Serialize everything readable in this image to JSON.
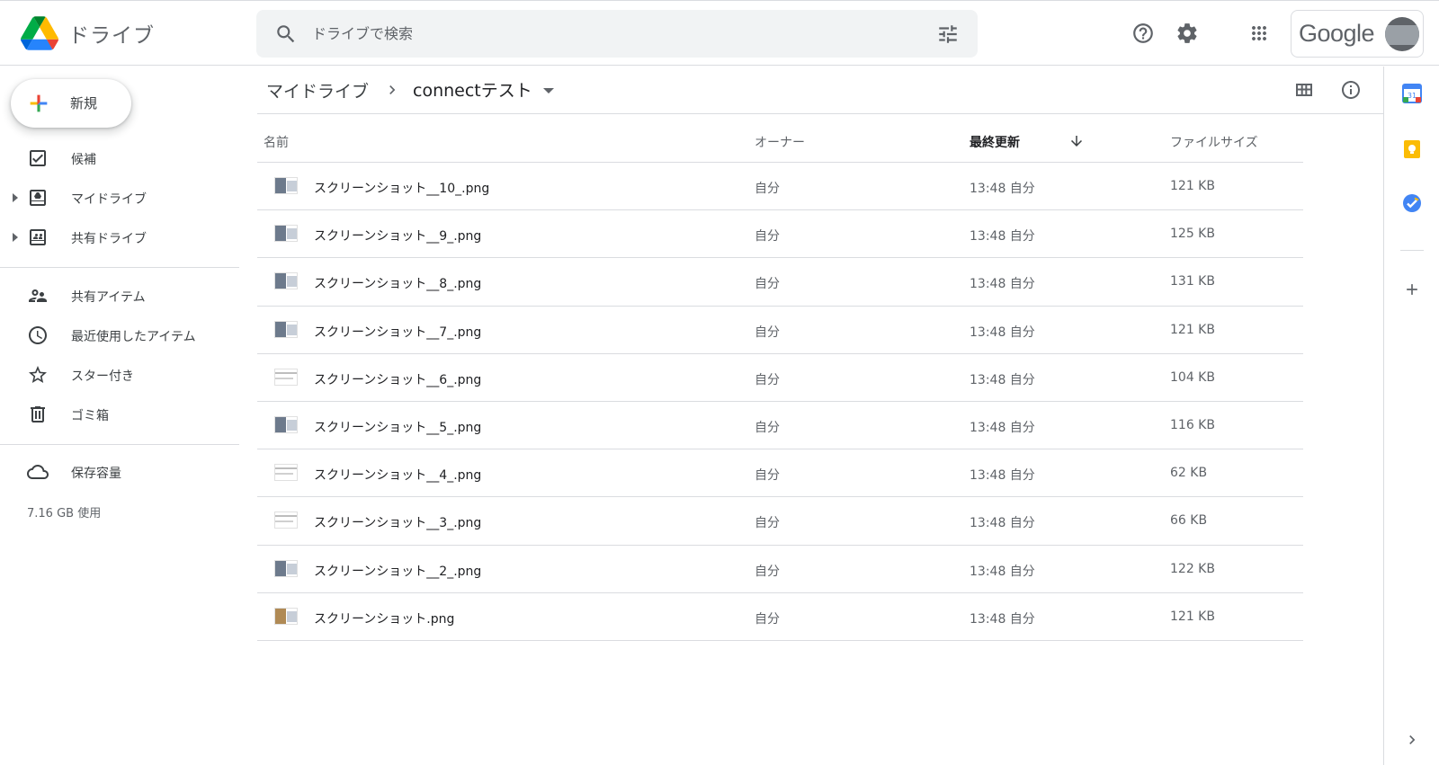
{
  "header": {
    "app_name": "ドライブ",
    "search_placeholder": "ドライブで検索",
    "account_label": "Google"
  },
  "sidebar": {
    "new_label": "新規",
    "items": [
      {
        "label": "候補",
        "icon": "check-box-icon"
      },
      {
        "label": "マイドライブ",
        "icon": "my-drive-icon"
      },
      {
        "label": "共有ドライブ",
        "icon": "shared-drive-icon"
      },
      {
        "label": "共有アイテム",
        "icon": "people-icon"
      },
      {
        "label": "最近使用したアイテム",
        "icon": "clock-icon"
      },
      {
        "label": "スター付き",
        "icon": "star-icon"
      },
      {
        "label": "ゴミ箱",
        "icon": "trash-icon"
      },
      {
        "label": "保存容量",
        "icon": "cloud-icon"
      }
    ],
    "storage_used": "7.16 GB 使用"
  },
  "breadcrumb": {
    "root": "マイドライブ",
    "current": "connectテスト"
  },
  "table": {
    "columns": [
      "名前",
      "オーナー",
      "最終更新",
      "ファイルサイズ"
    ],
    "rows": [
      {
        "name": "スクリーンショット__10_.png",
        "owner": "自分",
        "modified": "13:48 自分",
        "size": "121 KB"
      },
      {
        "name": "スクリーンショット__9_.png",
        "owner": "自分",
        "modified": "13:48 自分",
        "size": "125 KB"
      },
      {
        "name": "スクリーンショット__8_.png",
        "owner": "自分",
        "modified": "13:48 自分",
        "size": "131 KB"
      },
      {
        "name": "スクリーンショット__7_.png",
        "owner": "自分",
        "modified": "13:48 自分",
        "size": "121 KB"
      },
      {
        "name": "スクリーンショット__6_.png",
        "owner": "自分",
        "modified": "13:48 自分",
        "size": "104 KB"
      },
      {
        "name": "スクリーンショット__5_.png",
        "owner": "自分",
        "modified": "13:48 自分",
        "size": "116 KB"
      },
      {
        "name": "スクリーンショット__4_.png",
        "owner": "自分",
        "modified": "13:48 自分",
        "size": "62 KB"
      },
      {
        "name": "スクリーンショット__3_.png",
        "owner": "自分",
        "modified": "13:48 自分",
        "size": "66 KB"
      },
      {
        "name": "スクリーンショット__2_.png",
        "owner": "自分",
        "modified": "13:48 自分",
        "size": "122 KB"
      },
      {
        "name": "スクリーンショット.png",
        "owner": "自分",
        "modified": "13:48 自分",
        "size": "121 KB"
      }
    ]
  },
  "side_panel": {
    "calendar_day": "31"
  }
}
